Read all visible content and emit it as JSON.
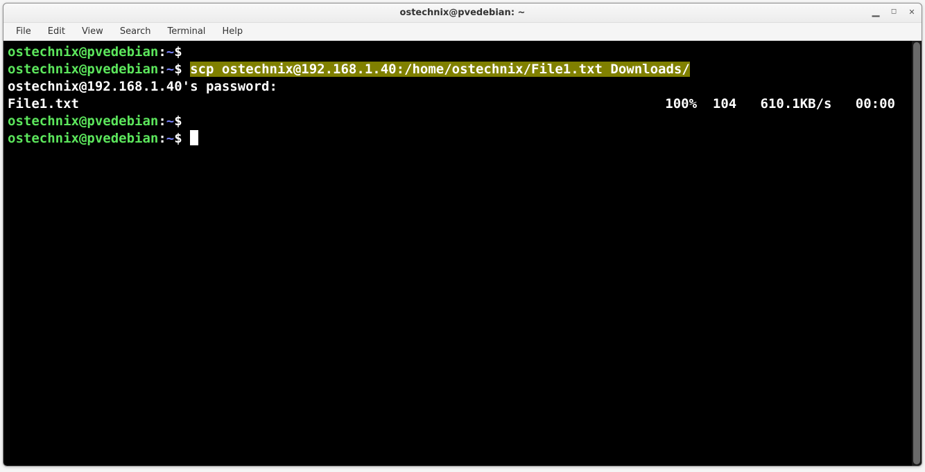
{
  "window": {
    "title": "ostechnix@pvedebian: ~"
  },
  "menubar": {
    "items": [
      {
        "label": "File"
      },
      {
        "label": "Edit"
      },
      {
        "label": "View"
      },
      {
        "label": "Search"
      },
      {
        "label": "Terminal"
      },
      {
        "label": "Help"
      }
    ]
  },
  "window_controls": {
    "minimize": "▁",
    "maximize": "◻",
    "close": "✕"
  },
  "prompt": {
    "user_host": "ostechnix@pvedebian",
    "colon": ":",
    "path": "~",
    "dollar": "$"
  },
  "lines": {
    "line1_cmd": "",
    "line2_cmd": "scp ostechnix@192.168.1.40:/home/ostechnix/File1.txt Downloads/",
    "line3_text": "ostechnix@192.168.1.40's password:",
    "line4_filename": "File1.txt",
    "line4_stats": "100%  104   610.1KB/s   00:00",
    "line5_cmd": "",
    "line6_cmd": ""
  }
}
